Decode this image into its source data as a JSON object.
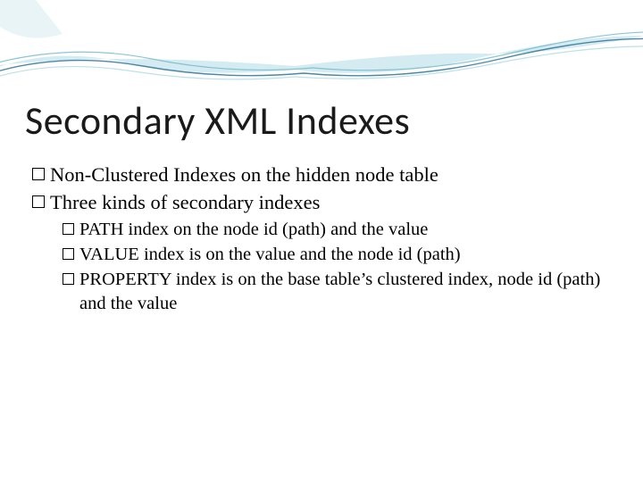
{
  "title": "Secondary XML Indexes",
  "bullets": {
    "b1": "Non-Clustered Indexes on the hidden node table",
    "b2": "Three kinds of secondary indexes",
    "b2_1": "PATH index on the node id (path) and the value",
    "b2_2": "VALUE index is on the value and the node id (path)",
    "b2_3": "PROPERTY index is on the base table’s clustered index, node id (path) and the value"
  },
  "theme": {
    "wave_color_light": "#b8e0e8",
    "wave_color_dark": "#3a7a9c",
    "background": "#ffffff"
  }
}
